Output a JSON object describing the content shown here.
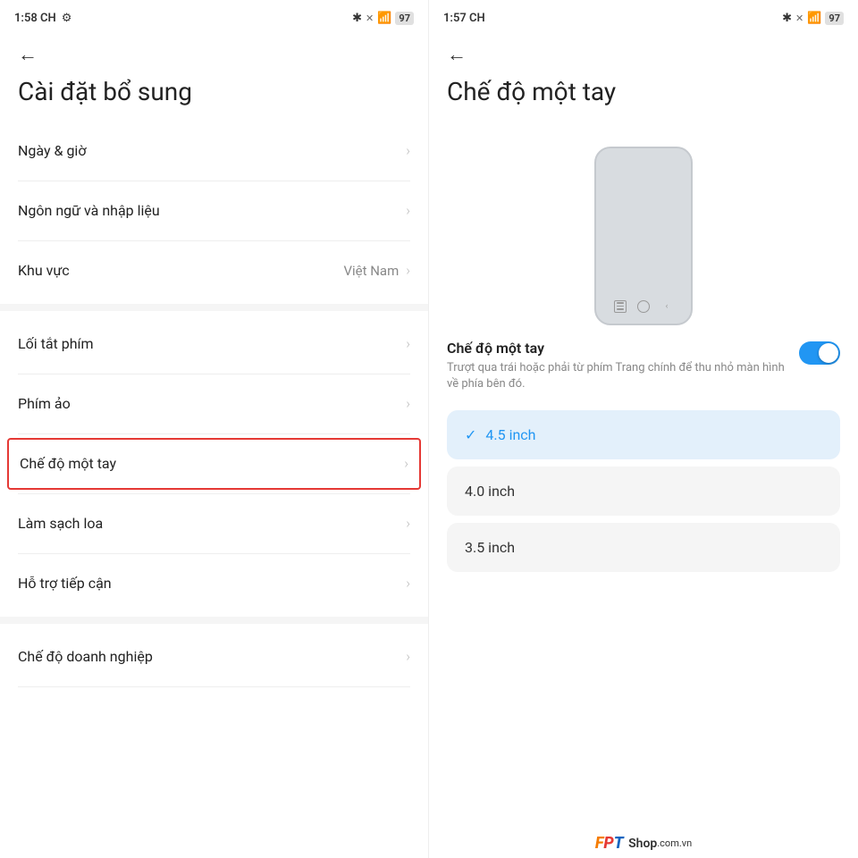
{
  "left": {
    "status": {
      "time": "1:58 CH",
      "battery": "97"
    },
    "back_label": "←",
    "title": "Cài đặt bổ sung",
    "menu_items": [
      {
        "id": "datetime",
        "label": "Ngày & giờ",
        "value": "",
        "highlighted": false
      },
      {
        "id": "language",
        "label": "Ngôn ngữ và nhập liệu",
        "value": "",
        "highlighted": false
      },
      {
        "id": "region",
        "label": "Khu vực",
        "value": "Việt Nam",
        "highlighted": false
      },
      {
        "id": "shortcut",
        "label": "Lối tắt phím",
        "value": "",
        "highlighted": false
      },
      {
        "id": "virtualkey",
        "label": "Phím ảo",
        "value": "",
        "highlighted": false
      },
      {
        "id": "onehand",
        "label": "Chế độ một tay",
        "value": "",
        "highlighted": true
      },
      {
        "id": "cleaner",
        "label": "Làm sạch loa",
        "value": "",
        "highlighted": false
      },
      {
        "id": "accessibility",
        "label": "Hỗ trợ tiếp cận",
        "value": "",
        "highlighted": false
      },
      {
        "id": "enterprise",
        "label": "Chế độ doanh nghiệp",
        "value": "",
        "highlighted": false
      }
    ]
  },
  "right": {
    "status": {
      "time": "1:57 CH",
      "battery": "97"
    },
    "back_label": "←",
    "title": "Chế độ một tay",
    "setting": {
      "label": "Chế độ một tay",
      "description": "Trượt qua trái hoặc phải từ phím Trang chính để thu nhỏ màn hình về phía bên đó.",
      "toggle_on": true
    },
    "size_options": [
      {
        "id": "4.5",
        "label": "4.5 inch",
        "selected": true
      },
      {
        "id": "4.0",
        "label": "4.0 inch",
        "selected": false
      },
      {
        "id": "3.5",
        "label": "3.5 inch",
        "selected": false
      }
    ],
    "watermark": "FPT Shop.com.vn"
  }
}
